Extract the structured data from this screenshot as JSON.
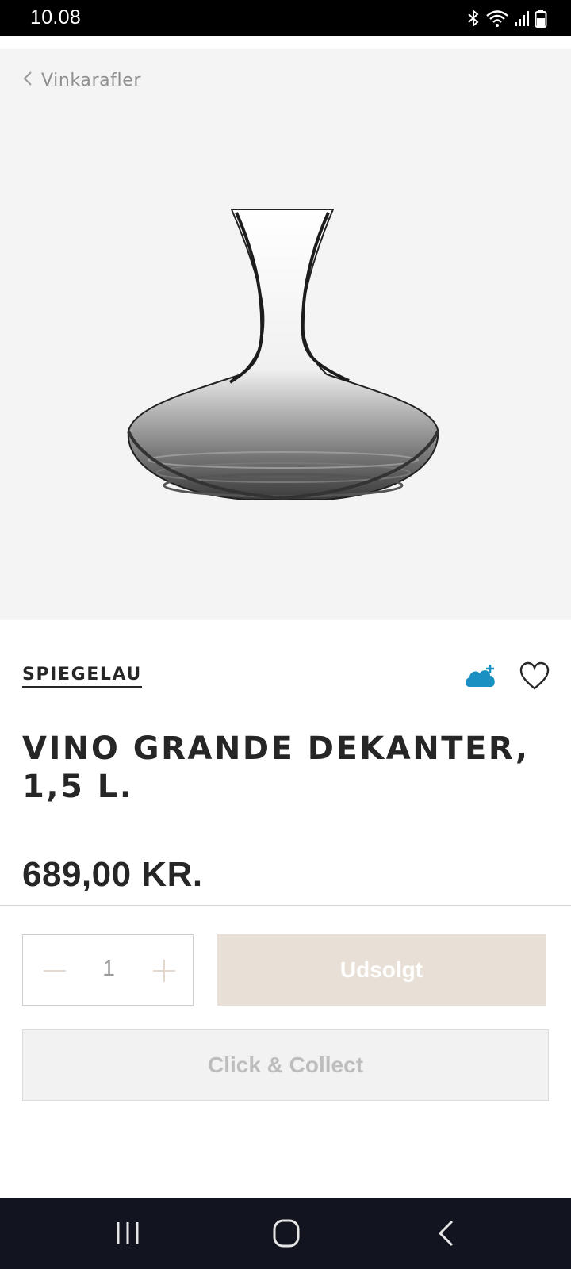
{
  "status_bar": {
    "time": "10.08",
    "icons": [
      "bluetooth-icon",
      "wifi-icon",
      "signal-icon",
      "battery-icon"
    ]
  },
  "breadcrumb": {
    "label": "Vinkarafler",
    "icon": "chevron-left-icon"
  },
  "product": {
    "brand": "SPIEGELAU",
    "title": "VINO GRANDE DEKANTER, 1,5 L.",
    "price": "689,00 KR.",
    "image_icon": "decanter-image"
  },
  "actions": {
    "cloud_icon": "cloud-add-icon",
    "favorite_icon": "heart-icon",
    "accent_color": "#1a8fc1"
  },
  "quantity": {
    "value": "1",
    "minus_icon": "minus-icon",
    "plus_icon": "plus-icon"
  },
  "buttons": {
    "soldout_label": "Udsolgt",
    "collect_label": "Click & Collect"
  },
  "nav": {
    "icons": [
      "recent-apps-icon",
      "home-icon",
      "back-icon"
    ]
  }
}
